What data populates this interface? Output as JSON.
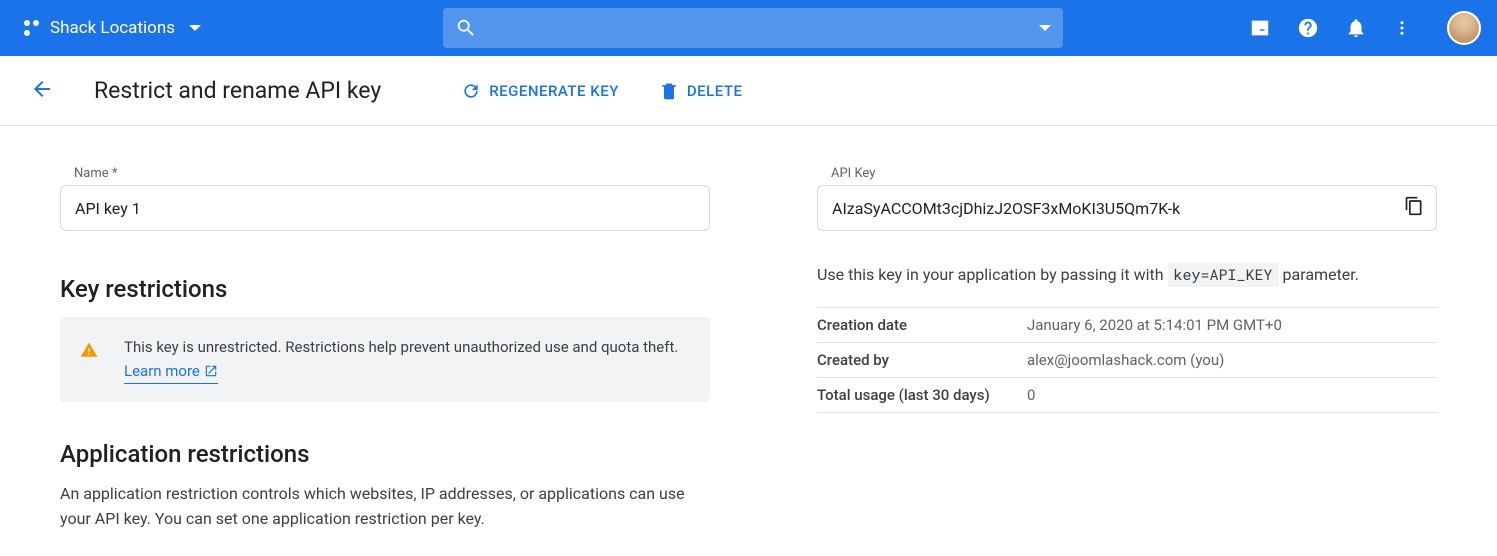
{
  "header": {
    "project_name": "Shack Locations"
  },
  "page": {
    "title": "Restrict and rename API key",
    "regenerate_label": "REGENERATE KEY",
    "delete_label": "DELETE"
  },
  "left": {
    "name_label": "Name *",
    "name_value": "API key 1",
    "key_restrictions_title": "Key restrictions",
    "warning_text": "This key is unrestricted. Restrictions help prevent unauthorized use and quota theft. ",
    "learn_more_label": "Learn more",
    "app_restrictions_title": "Application restrictions",
    "app_restrictions_desc": "An application restriction controls which websites, IP addresses, or applications can use your API key. You can set one application restriction per key."
  },
  "right": {
    "api_key_label": "API Key",
    "api_key_value": "AIzaSyACCOMt3cjDhizJ2OSF3xMoKI3U5Qm7K-k",
    "hint_prefix": "Use this key in your application by passing it with ",
    "hint_code": "key=API_KEY",
    "hint_suffix": " parameter.",
    "meta": [
      {
        "label": "Creation date",
        "value": "January 6, 2020 at 5:14:01 PM GMT+0"
      },
      {
        "label": "Created by",
        "value": "alex@joomlashack.com (you)"
      },
      {
        "label": "Total usage (last 30 days)",
        "value": "0"
      }
    ]
  }
}
